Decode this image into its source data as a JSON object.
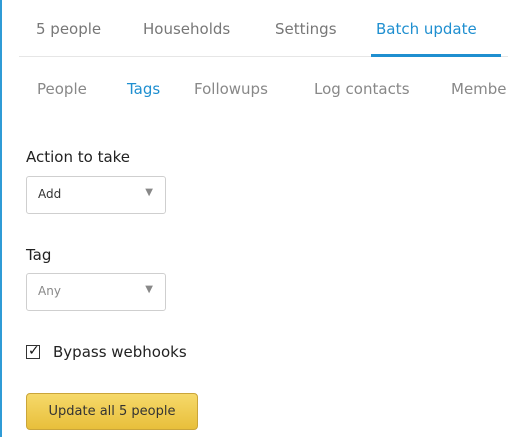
{
  "top_tabs": [
    {
      "label": "5 people"
    },
    {
      "label": "Households"
    },
    {
      "label": "Settings"
    },
    {
      "label": "Batch update",
      "active": true
    }
  ],
  "sub_tabs": [
    {
      "label": "People"
    },
    {
      "label": "Tags",
      "active": true
    },
    {
      "label": "Followups"
    },
    {
      "label": "Log contacts"
    },
    {
      "label": "Membe"
    }
  ],
  "form": {
    "action": {
      "label": "Action to take",
      "value": "Add"
    },
    "tag": {
      "label": "Tag",
      "value": "Any"
    },
    "bypass_webhooks": {
      "label": "Bypass webhooks",
      "checked": true
    },
    "submit_label": "Update all 5 people"
  },
  "colors": {
    "accent": "#1f8fd0",
    "frame": "#2f9bd6",
    "button": "#f1cf55"
  },
  "icons": {
    "dropdown": "▼",
    "check": "✓"
  }
}
